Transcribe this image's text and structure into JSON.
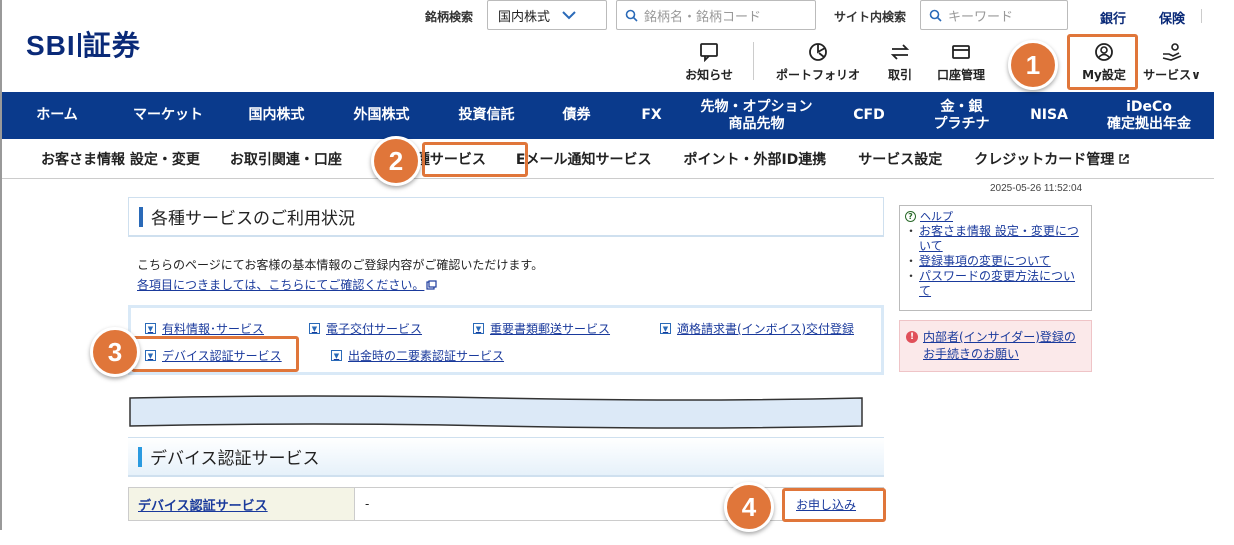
{
  "header": {
    "logo_left": "SBI",
    "logo_right": "証券",
    "stock_search_label": "銘柄検索",
    "market_select": "国内株式",
    "stock_search_placeholder": "銘柄名・銘柄コード",
    "site_search_label": "サイト内検索",
    "site_search_placeholder": "キーワード",
    "bank_link": "銀行",
    "insurance_link": "保険",
    "icons": [
      {
        "label": "お知らせ",
        "icon": "notice-icon"
      },
      {
        "label": "ポートフォリオ",
        "icon": "portfolio-icon"
      },
      {
        "label": "取引",
        "icon": "trade-icon"
      },
      {
        "label": "口座管理",
        "icon": "account-icon"
      },
      {
        "label": "My設定",
        "icon": "my-settings-icon"
      },
      {
        "label": "サービス",
        "icon": "service-icon"
      }
    ]
  },
  "main_nav": [
    "ホーム",
    "マーケット",
    "国内株式",
    "外国株式",
    "投資信託",
    "債券",
    "FX",
    "先物・オプション\n商品先物",
    "CFD",
    "金・銀\nプラチナ",
    "NISA",
    "iDeCo\n確定拠出年金"
  ],
  "sub_nav": [
    "お客さま情報 設定・変更",
    "お取引関連・口座",
    "各種サービス",
    "Eメール通知サービス",
    "ポイント・外部ID連携",
    "サービス設定",
    "クレジットカード管理"
  ],
  "timestamp": "2025-05-26 11:52:04",
  "page_title": "各種サービスのご利用状況",
  "description": "こちらのページにてお客様の基本情報のご登録内容がご確認いただけます。",
  "description_link": "各項目につきましては、こちらにてご確認ください。",
  "service_links": [
    "有料情報･サービス",
    "電子交付サービス",
    "重要書類郵送サービス",
    "適格請求書(インボイス)交付登録",
    "デバイス認証サービス",
    "出金時の二要素認証サービス"
  ],
  "section_title": "デバイス認証サービス",
  "table": {
    "label": "デバイス認証サービス",
    "value": "-",
    "apply_link": "お申し込み"
  },
  "help": {
    "title": "ヘルプ",
    "items": [
      "お客さま情報 設定・変更について",
      "登録事項の変更について",
      "パスワードの変更方法について"
    ]
  },
  "alert": "内部者(インサイダー)登録のお手続きのお願い",
  "annotations": [
    "1",
    "2",
    "3",
    "4"
  ],
  "colors": {
    "accent": "#e0763a",
    "nav": "#0a3a8c",
    "link": "#1a3a9c"
  }
}
